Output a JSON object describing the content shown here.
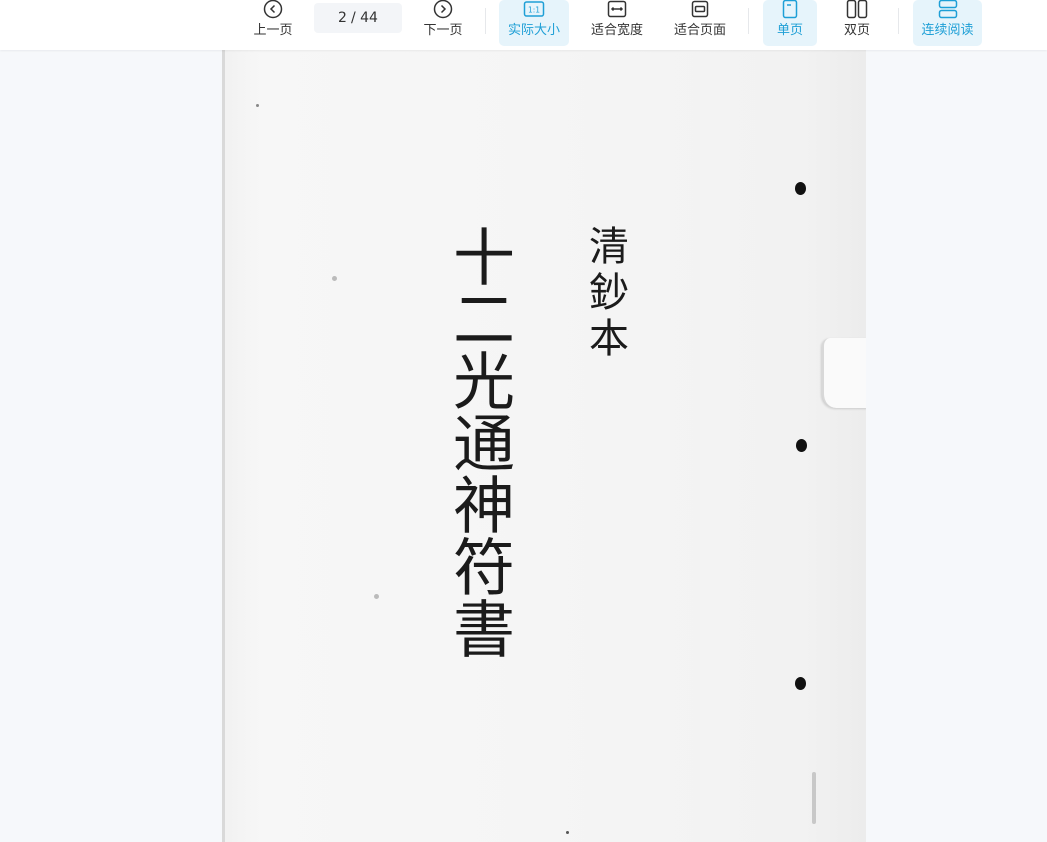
{
  "toolbar": {
    "prev_label": "上一页",
    "page_current": "2",
    "page_total": "/ 44",
    "next_label": "下一页",
    "actual_size_label": "实际大小",
    "fit_width_label": "适合宽度",
    "fit_page_label": "适合页面",
    "single_page_label": "单页",
    "double_page_label": "双页",
    "continuous_label": "连续阅读",
    "actual_size_icon_text": "1:1",
    "accent": "#1e9fd6"
  },
  "document": {
    "title_main": "十二光通神符書",
    "title_sub": "清鈔本"
  }
}
